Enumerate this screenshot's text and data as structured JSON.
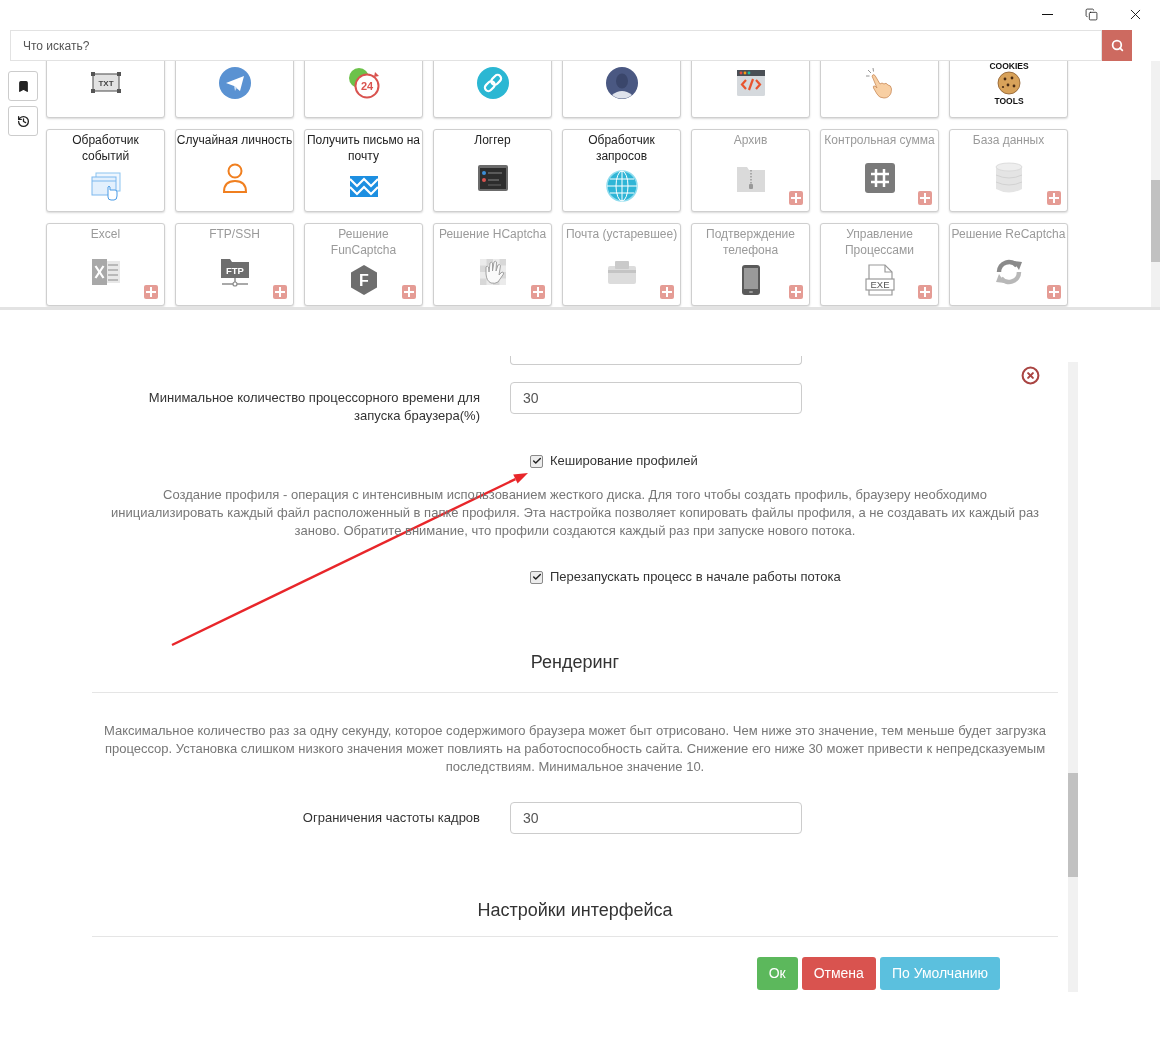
{
  "search": {
    "placeholder": "Что искать?"
  },
  "tiles": [
    {
      "disabled": false,
      "icon_text": [
        "TXT"
      ]
    },
    {
      "disabled": false
    },
    {
      "disabled": false,
      "icon_text": [
        "24"
      ]
    },
    {
      "disabled": false
    },
    {
      "disabled": false
    },
    {
      "disabled": false
    },
    {
      "disabled": false
    },
    {
      "disabled": false,
      "icon_text": [
        "COOKIES",
        "TOOLS"
      ]
    },
    {
      "label": "Обработчик\nсобытий",
      "disabled": false
    },
    {
      "label": "Случайная личность",
      "disabled": false
    },
    {
      "label": "Получить письмо на\nпочту",
      "disabled": false
    },
    {
      "label": "Логгер",
      "disabled": false
    },
    {
      "label": "Обработчик\nзапросов",
      "disabled": false
    },
    {
      "label": "Архив",
      "disabled": true
    },
    {
      "label": "Контрольная сумма",
      "disabled": true
    },
    {
      "label": "База данных",
      "disabled": true
    },
    {
      "label": "Excel",
      "disabled": true
    },
    {
      "label": "FTP/SSH",
      "disabled": true,
      "icon_text": [
        "FTP"
      ]
    },
    {
      "label": "Решение\nFunCaptcha",
      "disabled": true,
      "icon_text": [
        "F"
      ]
    },
    {
      "label": "Решение HCaptcha",
      "disabled": true
    },
    {
      "label": "Почта (устаревшее)",
      "disabled": true
    },
    {
      "label": "Подтверждение\nтелефона",
      "disabled": true
    },
    {
      "label": "Управление\nПроцессами",
      "disabled": true,
      "icon_text": [
        "EXE"
      ]
    },
    {
      "label": "Решение ReCaptcha",
      "disabled": true
    }
  ],
  "form": {
    "items": [
      {
        "kind": "input",
        "label": "Минимальное количество процессорного времени для запуска браузера(%)",
        "value": "30"
      },
      {
        "kind": "checkbox",
        "label": "Кеширование профилей",
        "checked": true
      },
      {
        "kind": "help",
        "text": "Создание профиля - операция с интенсивным использованием жесткого диска. Для того чтобы создать профиль, браузеру необходимо\nинициализировать каждый файл расположенный в папке профиля. Эта настройка позволяет копировать файлы профиля, а не создавать их каждый раз\nзаново. Обратите внимание, что профили создаются каждый раз при запуске нового потока."
      },
      {
        "kind": "checkbox",
        "label": "Перезапускать процесс в начале работы потока",
        "checked": true
      },
      {
        "kind": "heading",
        "text": "Рендеринг"
      },
      {
        "kind": "help",
        "text": "Максимальное количество раз за одну секунду, которое содержимого браузера может быт отрисовано. Чем ниже это значение, тем меньше будет загрузка\nпроцессор. Установка слишком низкого значения может повлиять на работоспособность сайта. Снижение его ниже 30 может привести к непредсказуемым\nпоследствиям. Минимальное значение 10."
      },
      {
        "kind": "input",
        "label": "Ограничения частоты кадров",
        "value": "30"
      },
      {
        "kind": "heading",
        "text": "Настройки интерфейса"
      }
    ]
  },
  "buttons": [
    {
      "kind": "ok",
      "label": "Ок"
    },
    {
      "kind": "cancel",
      "label": "Отмена"
    },
    {
      "kind": "default",
      "label": "По Умолчанию"
    }
  ]
}
